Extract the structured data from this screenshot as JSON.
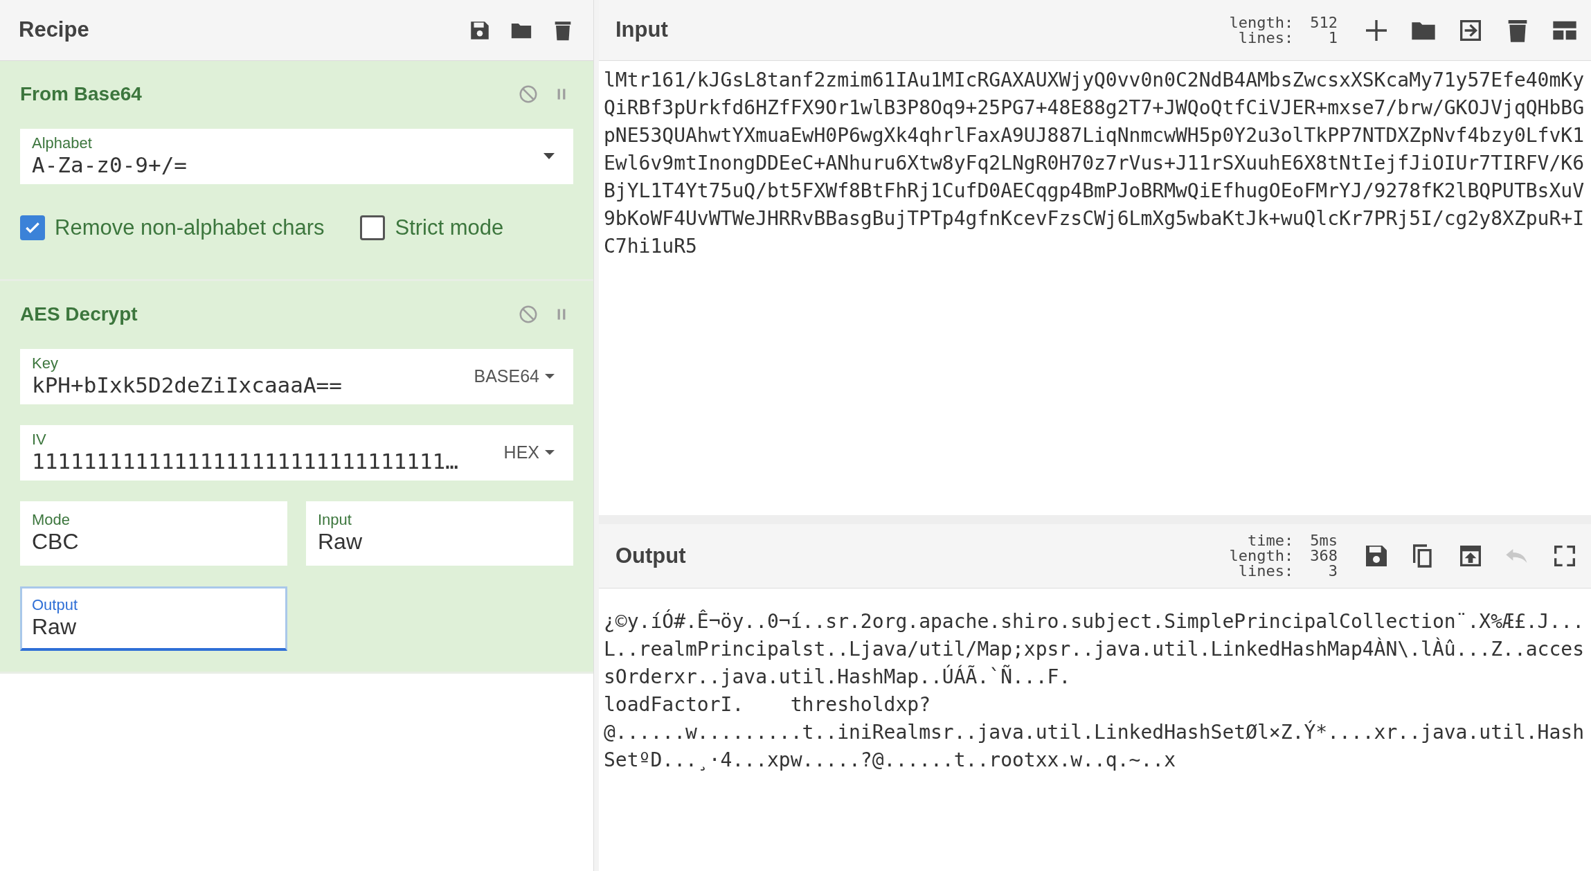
{
  "recipe": {
    "title": "Recipe",
    "tools": [
      {
        "kind": "save"
      },
      {
        "kind": "folder"
      },
      {
        "kind": "trash"
      }
    ]
  },
  "operations": [
    {
      "title": "From Base64",
      "fields": [
        {
          "kind": "select",
          "label": "Alphabet",
          "value": "A-Za-z0-9+/=",
          "focused": false
        }
      ],
      "checkboxes": [
        {
          "label": "Remove non-alphabet chars",
          "checked": true
        },
        {
          "label": "Strict mode",
          "checked": false
        }
      ]
    },
    {
      "title": "AES Decrypt",
      "fields": [
        {
          "kind": "toggle",
          "label": "Key",
          "value": "kPH+bIxk5D2deZiIxcaaaA==",
          "option": "BASE64",
          "focused": false
        },
        {
          "kind": "toggle",
          "label": "IV",
          "value": "11111111111111111111111111111111…",
          "option": "HEX",
          "focused": false
        },
        {
          "kind": "half",
          "label": "Mode",
          "value": "CBC",
          "focused": false
        },
        {
          "kind": "half",
          "label": "Input",
          "value": "Raw",
          "focused": false
        },
        {
          "kind": "half",
          "label": "Output",
          "value": "Raw",
          "focused": true
        }
      ]
    }
  ],
  "input": {
    "title": "Input",
    "stats": [
      {
        "label": "length:",
        "value": "512"
      },
      {
        "label": "lines:",
        "value": "1"
      }
    ],
    "tools": [
      {
        "kind": "plus",
        "disabled": false
      },
      {
        "kind": "folder",
        "disabled": false
      },
      {
        "kind": "import",
        "disabled": false
      },
      {
        "kind": "trash",
        "disabled": false
      },
      {
        "kind": "layout",
        "disabled": false
      }
    ],
    "text": "lMtr161/kJGsL8tanf2zmim61IAu1MIcRGAXAUXWjyQ0vv0n0C2NdB4AMbsZwcsxXSKcaMy71y57Efe40mKyQiRBf3pUrkfd6HZfFX9Or1wlB3P8Oq9+25PG7+48E88g2T7+JWQoQtfCiVJER+mxse7/brw/GKOJVjqQHbBGpNE53QUAhwtYXmuaEwH0P6wgXk4qhrlFaxA9UJ887LiqNnmcwWH5p0Y2u3olTkPP7NTDXZpNvf4bzy0LfvK1Ewl6v9mtInongDDEeC+ANhuru6Xtw8yFq2LNgR0H70z7rVus+J11rSXuuhE6X8tNtIejfJiOIUr7TIRFV/K6BjYL1T4Yt75uQ/bt5FXWf8BtFhRj1CufD0AECqgp4BmPJoBRMwQiEfhugOEoFMrYJ/9278fK2lBQPUTBsXuV9bKoWF4UvWTWeJHRRvBBasgBujTPTp4gfnKcevFzsCWj6LmXg5wbaKtJk+wuQlcKr7PRj5I/cg2y8XZpuR+IC7hi1uR5"
  },
  "output": {
    "title": "Output",
    "stats": [
      {
        "label": "time:",
        "value": "5ms"
      },
      {
        "label": "length:",
        "value": "368"
      },
      {
        "label": "lines:",
        "value": "3"
      }
    ],
    "tools": [
      {
        "kind": "save",
        "disabled": false
      },
      {
        "kind": "copy",
        "disabled": false
      },
      {
        "kind": "replace",
        "disabled": false
      },
      {
        "kind": "undo",
        "disabled": true
      },
      {
        "kind": "maximize",
        "disabled": false
      }
    ],
    "text": "¿©y.íÓ#.Ê¬öy..0¬í..sr.2org.apache.shiro.subject.SimplePrincipalCollection¨.X%Æ£.J...L..realmPrincipalst..Ljava/util/Map;xpsr..java.util.LinkedHashMap4ÀN\\.lÀû...Z..accessOrderxr..java.util.HashMap..ÚÁÃ.`Ñ...F.\nloadFactorI.\tthresholdxp?\n@......w.........t..iniRealmsr..java.util.LinkedHashSetØl×Z.Ý*....xr..java.util.HashSetºD...¸·4...xpw.....?@......t..rootxx.w..q.~..x"
  }
}
